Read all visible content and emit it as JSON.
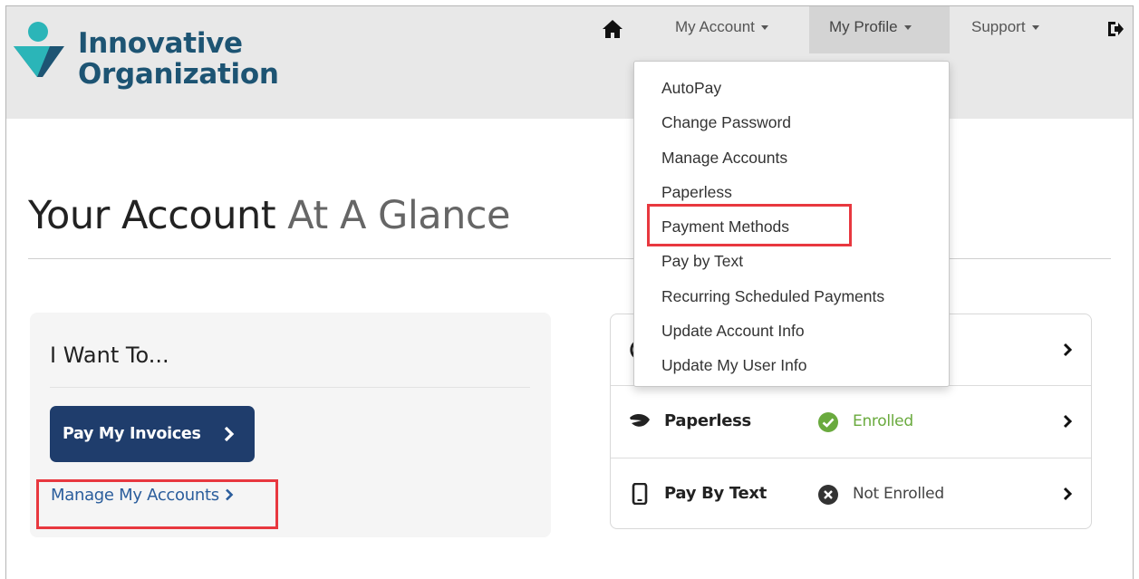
{
  "colors": {
    "brand_dark": "#1d5473",
    "brand_teal": "#2bb5b8",
    "button_navy": "#1f3d6c",
    "link_blue": "#2a5d9c",
    "enrolled_green": "#6aaa3e",
    "highlight_red": "#e8383f"
  },
  "logo": {
    "line1": "Innovative",
    "line2": "Organization"
  },
  "nav": {
    "home_icon": "home-icon",
    "my_account": "My Account",
    "my_profile": "My Profile",
    "support": "Support",
    "logout_icon": "sign-out-icon"
  },
  "profile_menu": {
    "items": [
      "AutoPay",
      "Change Password",
      "Manage Accounts",
      "Paperless",
      "Payment Methods",
      "Pay by Text",
      "Recurring Scheduled Payments",
      "Update Account Info",
      "Update My User Info"
    ],
    "highlighted": "Payment Methods"
  },
  "page": {
    "title_bold": "Your Account",
    "title_light": "At A Glance"
  },
  "i_want_to": {
    "heading": "I Want To...",
    "pay_button": "Pay My Invoices",
    "manage_link": "Manage My Accounts",
    "manage_highlighted": true
  },
  "status_rows": [
    {
      "label": "",
      "status": "",
      "icon": "partially-hidden-icon"
    },
    {
      "label": "Paperless",
      "status": "Enrolled",
      "icon": "leaf-icon",
      "status_icon": "check-circle-icon"
    },
    {
      "label": "Pay By Text",
      "status": "Not Enrolled",
      "icon": "mobile-phone-icon",
      "status_icon": "x-circle-icon"
    }
  ]
}
